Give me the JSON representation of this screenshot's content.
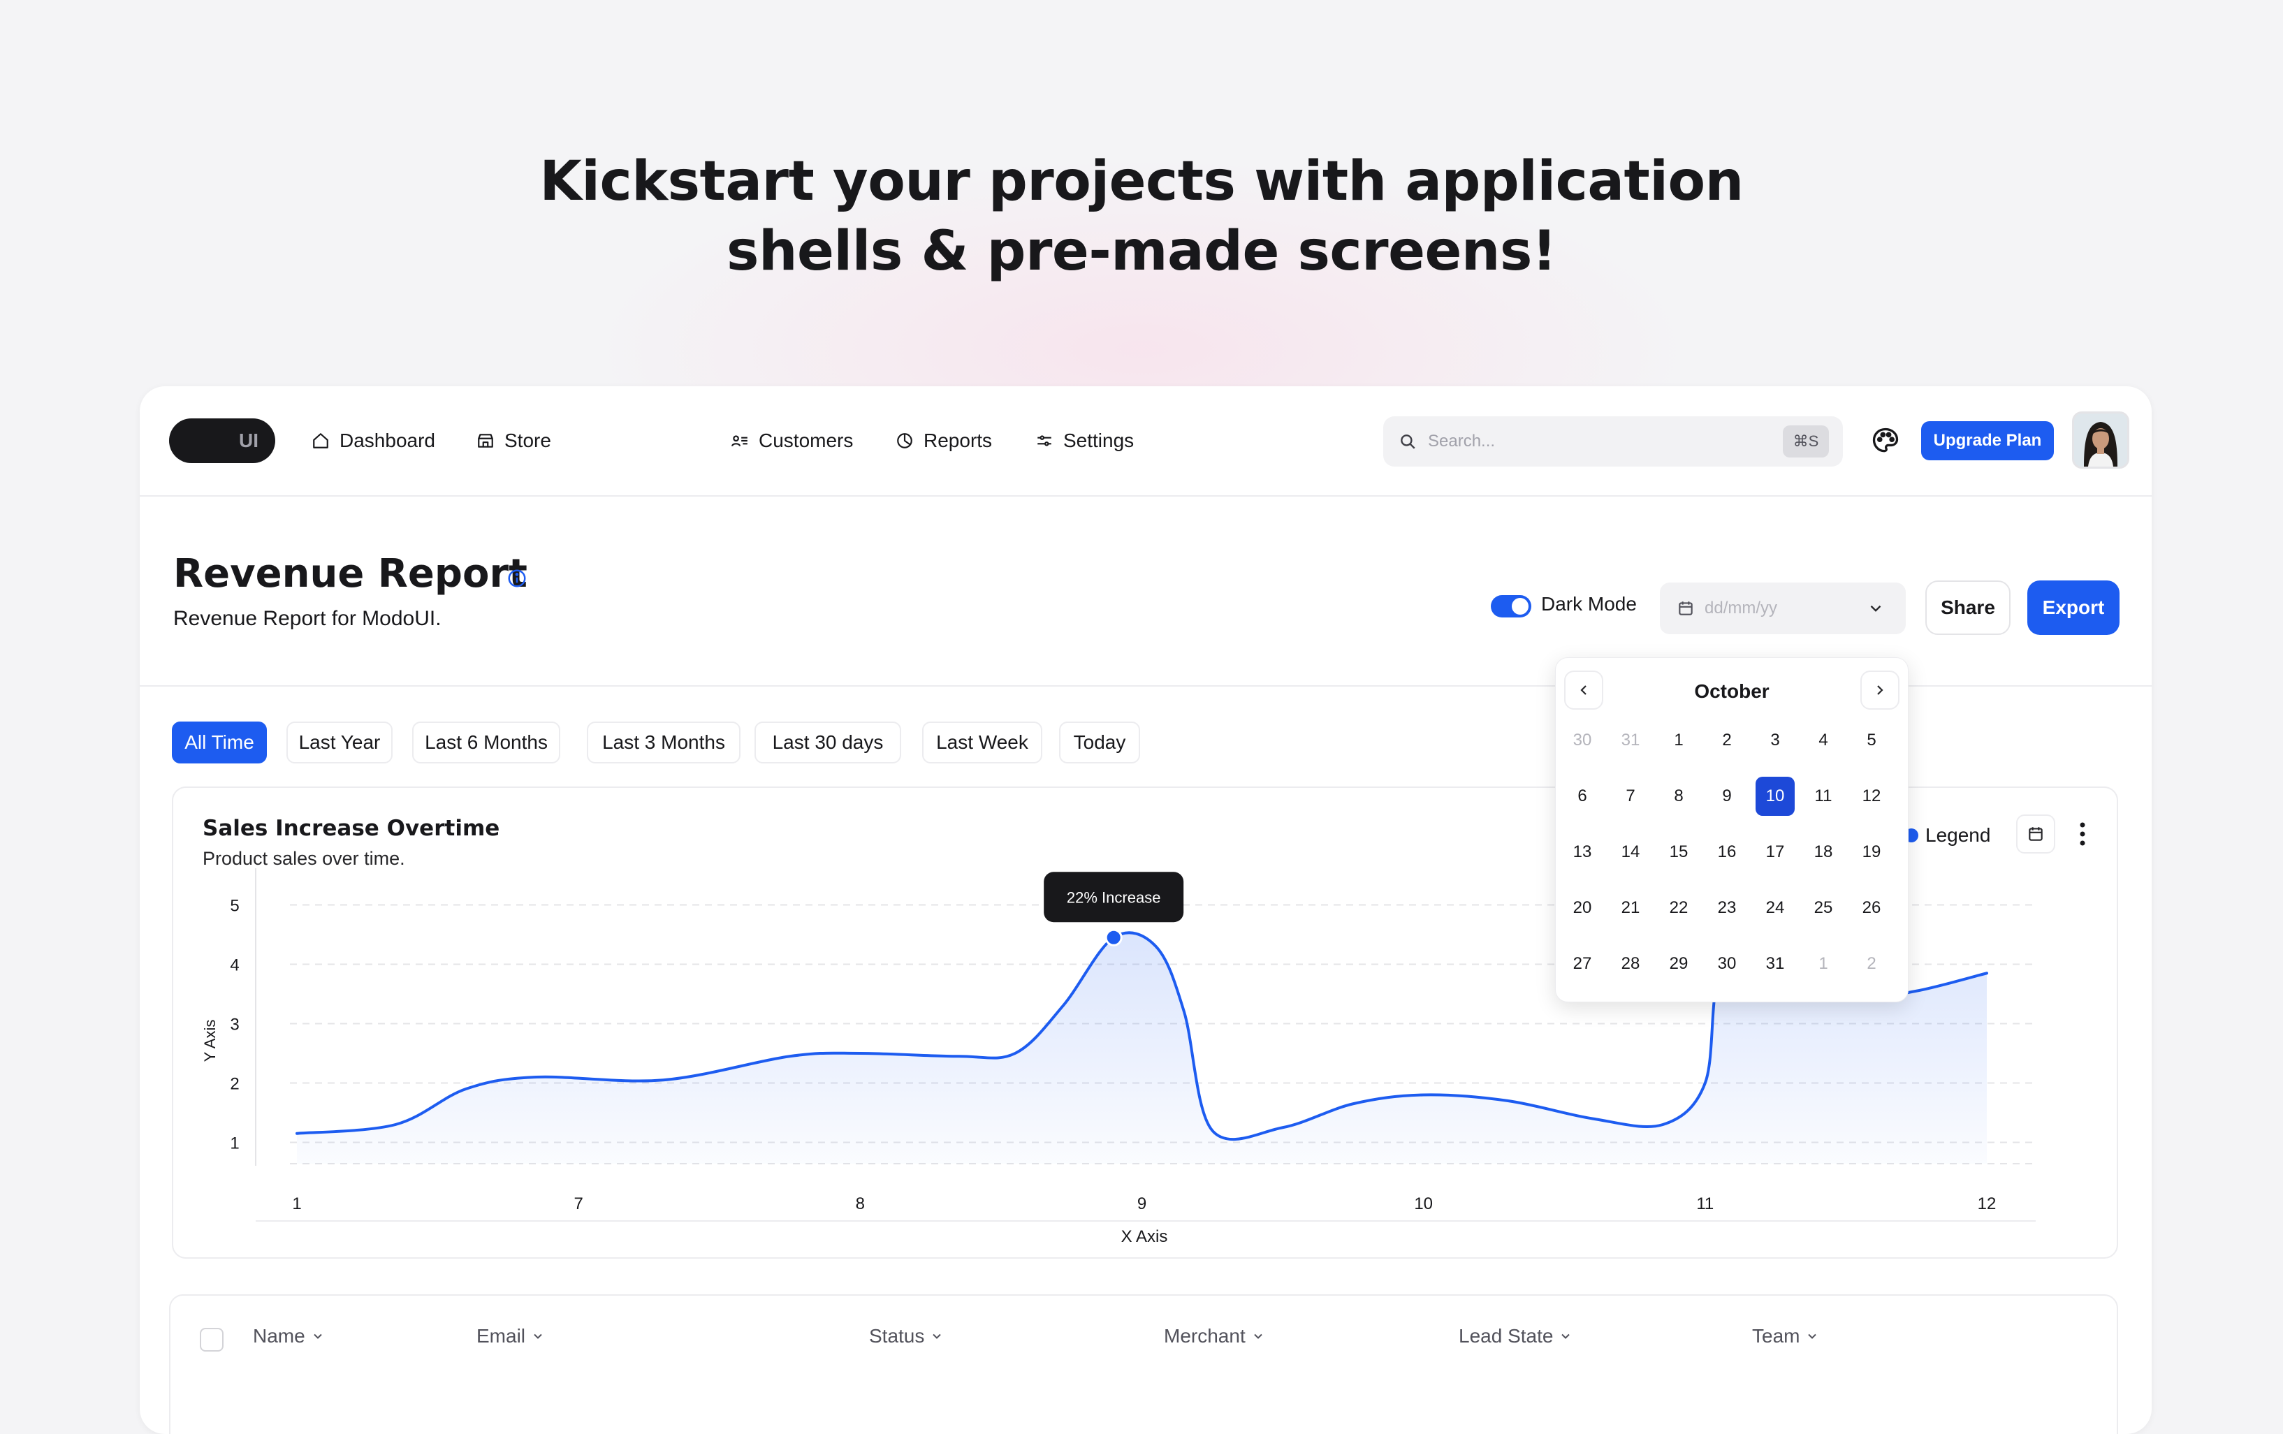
{
  "hero": {
    "line1": "Kickstart your projects with application",
    "line2": "shells & pre-made screens!"
  },
  "nav": {
    "logo_text": "UI",
    "items": [
      {
        "label": "Dashboard",
        "icon": "home-icon"
      },
      {
        "label": "Store",
        "icon": "store-icon"
      },
      {
        "label": "Customers",
        "icon": "customers-icon"
      },
      {
        "label": "Reports",
        "icon": "pie-chart-icon"
      },
      {
        "label": "Settings",
        "icon": "sliders-icon"
      }
    ],
    "search_placeholder": "Search...",
    "search_shortcut": "⌘S",
    "upgrade_label": "Upgrade Plan"
  },
  "header": {
    "title": "Revenue Report",
    "subtitle": "Revenue Report for ModoUI.",
    "dark_mode_label": "Dark Mode",
    "dark_mode_on": true,
    "date_placeholder": "dd/mm/yy",
    "share_label": "Share",
    "export_label": "Export"
  },
  "filters": [
    "All Time",
    "Last Year",
    "Last 6 Months",
    "Last 3 Months",
    "Last 30 days",
    "Last Week",
    "Today"
  ],
  "active_filter": "All Time",
  "chart": {
    "title": "Sales Increase Overtime",
    "subtitle": "Product sales over time.",
    "legend_label": "Legend",
    "tooltip": "22% Increase"
  },
  "chart_data": {
    "type": "area",
    "xlabel": "X Axis",
    "ylabel": "Y Axis",
    "x_ticks": [
      "1",
      "7",
      "8",
      "9",
      "10",
      "11",
      "12"
    ],
    "y_ticks": [
      1,
      2,
      3,
      4,
      5
    ],
    "ylim": [
      0.7,
      5.5
    ],
    "grid": true,
    "series": [
      {
        "color": "#1d5cf0",
        "points": [
          [
            0,
            1.15
          ],
          [
            0.35,
            1.3
          ],
          [
            0.6,
            1.9
          ],
          [
            0.85,
            2.1
          ],
          [
            1.3,
            2.05
          ],
          [
            1.75,
            2.45
          ],
          [
            2.0,
            2.5
          ],
          [
            2.35,
            2.45
          ],
          [
            2.55,
            2.5
          ],
          [
            2.72,
            3.3
          ],
          [
            2.9,
            4.45
          ],
          [
            3.05,
            4.3
          ],
          [
            3.15,
            3.2
          ],
          [
            3.25,
            1.2
          ],
          [
            3.5,
            1.25
          ],
          [
            3.75,
            1.65
          ],
          [
            4.0,
            1.8
          ],
          [
            4.3,
            1.7
          ],
          [
            4.6,
            1.4
          ],
          [
            4.85,
            1.3
          ],
          [
            5.0,
            2.0
          ],
          [
            5.05,
            3.8
          ],
          [
            5.2,
            4.1
          ],
          [
            5.35,
            3.8
          ],
          [
            5.55,
            3.45
          ],
          [
            5.75,
            3.55
          ],
          [
            6.0,
            3.85
          ]
        ],
        "highlight_index": 10
      }
    ]
  },
  "calendar": {
    "month": "October",
    "weeks": [
      [
        [
          "30",
          true
        ],
        [
          "31",
          true
        ],
        [
          "1",
          false
        ],
        [
          "2",
          false
        ],
        [
          "3",
          false
        ],
        [
          "4",
          false
        ],
        [
          "5",
          false
        ]
      ],
      [
        [
          "6",
          false
        ],
        [
          "7",
          false
        ],
        [
          "8",
          false
        ],
        [
          "9",
          false
        ],
        [
          "10",
          false
        ],
        [
          "11",
          false
        ],
        [
          "12",
          false
        ]
      ],
      [
        [
          "13",
          false
        ],
        [
          "14",
          false
        ],
        [
          "15",
          false
        ],
        [
          "16",
          false
        ],
        [
          "17",
          false
        ],
        [
          "18",
          false
        ],
        [
          "19",
          false
        ]
      ],
      [
        [
          "20",
          false
        ],
        [
          "21",
          false
        ],
        [
          "22",
          false
        ],
        [
          "23",
          false
        ],
        [
          "24",
          false
        ],
        [
          "25",
          false
        ],
        [
          "26",
          false
        ]
      ],
      [
        [
          "27",
          false
        ],
        [
          "28",
          false
        ],
        [
          "29",
          false
        ],
        [
          "30",
          false
        ],
        [
          "31",
          false
        ],
        [
          "1",
          true
        ],
        [
          "2",
          true
        ]
      ]
    ],
    "selected": "10"
  },
  "table": {
    "columns": [
      "Name",
      "Email",
      "Status",
      "Merchant",
      "Lead State",
      "Team"
    ]
  }
}
